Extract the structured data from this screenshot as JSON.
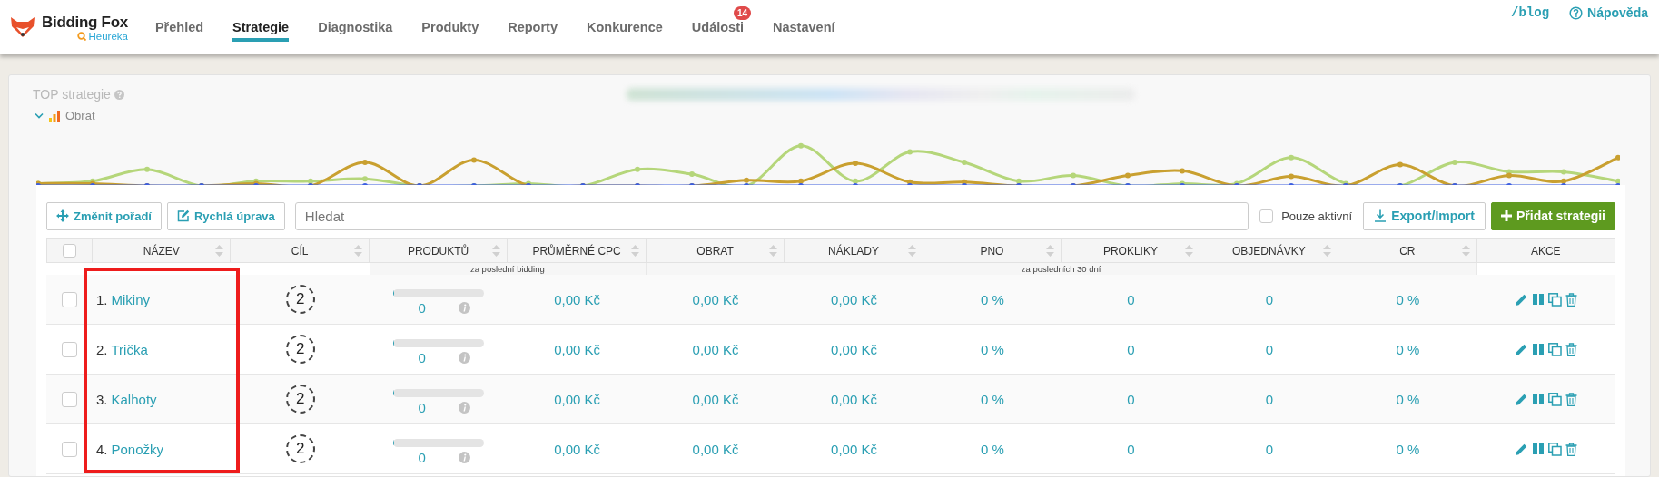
{
  "header": {
    "logo": {
      "title": "Bidding Fox",
      "subtitle": "Heureka"
    },
    "tabs": [
      {
        "label": "Přehled",
        "selected": false
      },
      {
        "label": "Strategie",
        "selected": true
      },
      {
        "label": "Diagnostika",
        "selected": false
      },
      {
        "label": "Produkty",
        "selected": false
      },
      {
        "label": "Reporty",
        "selected": false
      },
      {
        "label": "Konkurence",
        "selected": false
      },
      {
        "label": "Události",
        "selected": false,
        "badge": "14"
      },
      {
        "label": "Nastavení",
        "selected": false
      }
    ],
    "links": [
      {
        "kind": "blog",
        "label": "/blog"
      },
      {
        "kind": "help",
        "label": "Nápověda"
      }
    ]
  },
  "chart_card": {
    "title": "TOP strategie",
    "metric": "Obrat",
    "expanded": true
  },
  "toolbar": {
    "buttons": [
      {
        "kind": "reorder",
        "label": "Změnit pořadí"
      },
      {
        "kind": "quick-edit",
        "label": "Rychlá úprava"
      }
    ],
    "search": {
      "placeholder": "Hledat"
    },
    "filter": {
      "label": "Pouze aktivní",
      "checked": false
    },
    "actions": [
      {
        "kind": "export",
        "label": "Export/Import"
      },
      {
        "kind": "add",
        "label": "Přidat strategii"
      }
    ]
  },
  "table": {
    "columns": [
      {
        "label": "NÁZEV",
        "sortable": true
      },
      {
        "label": "CÍL",
        "sortable": true
      },
      {
        "label": "PRODUKTŮ",
        "sortable": true
      },
      {
        "label": "PRŮMĚRNÉ CPC",
        "sortable": true
      },
      {
        "label": "OBRAT",
        "sortable": true
      },
      {
        "label": "NÁKLADY",
        "sortable": true
      },
      {
        "label": "PNO",
        "sortable": true
      },
      {
        "label": "PROKLIKY",
        "sortable": true
      },
      {
        "label": "OBJEDNÁVKY",
        "sortable": true
      },
      {
        "label": "CR",
        "sortable": true
      },
      {
        "label": "AKCE",
        "sortable": false
      }
    ],
    "select_all": {
      "checked": false
    },
    "period_notes": [
      {
        "label": "za poslední bidding"
      },
      {
        "label": "za posledních 30 dní"
      }
    ],
    "rows": [
      {
        "checked": false,
        "index": "1.",
        "name": "Mikiny",
        "goal": "2",
        "products": "0",
        "level": 0,
        "cpc": "0,00 Kč",
        "obrat": "0,00 Kč",
        "naklady": "0,00 Kč",
        "pno": "0 %",
        "prokliky": "0",
        "objednavky": "0",
        "cr": "0 %"
      },
      {
        "checked": false,
        "index": "2.",
        "name": "Trička",
        "goal": "2",
        "products": "0",
        "level": 0,
        "cpc": "0,00 Kč",
        "obrat": "0,00 Kč",
        "naklady": "0,00 Kč",
        "pno": "0 %",
        "prokliky": "0",
        "objednavky": "0",
        "cr": "0 %"
      },
      {
        "checked": false,
        "index": "3.",
        "name": "Kalhoty",
        "goal": "2",
        "products": "0",
        "level": 0,
        "cpc": "0,00 Kč",
        "obrat": "0,00 Kč",
        "naklady": "0,00 Kč",
        "pno": "0 %",
        "prokliky": "0",
        "objednavky": "0",
        "cr": "0 %"
      },
      {
        "checked": false,
        "index": "4.",
        "name": "Ponožky",
        "goal": "2",
        "products": "0",
        "level": 0,
        "cpc": "0,00 Kč",
        "obrat": "0,00 Kč",
        "naklady": "0,00 Kč",
        "pno": "0 %",
        "prokliky": "0",
        "objednavky": "0",
        "cr": "0 %"
      }
    ]
  }
}
